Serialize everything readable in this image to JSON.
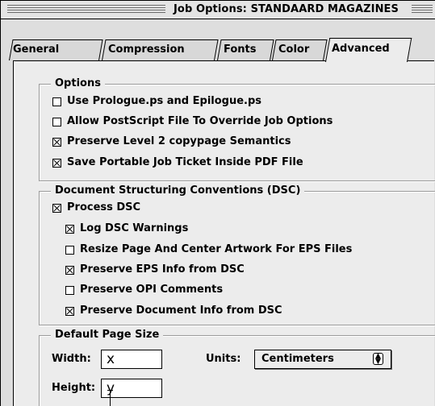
{
  "window": {
    "title": "Job Options: STANDAARD MAGAZINES"
  },
  "tabs": [
    {
      "label": "General",
      "active": false
    },
    {
      "label": "Compression",
      "active": false
    },
    {
      "label": "Fonts",
      "active": false
    },
    {
      "label": "Color",
      "active": false
    },
    {
      "label": "Advanced",
      "active": true
    }
  ],
  "options": {
    "title": "Options",
    "items": [
      {
        "label": "Use Prologue.ps and Epilogue.ps",
        "checked": false
      },
      {
        "label": "Allow PostScript File To Override Job Options",
        "checked": false
      },
      {
        "label": "Preserve Level 2 copypage Semantics",
        "checked": true
      },
      {
        "label": "Save Portable Job Ticket Inside PDF File",
        "checked": true
      }
    ]
  },
  "dsc": {
    "title": "Document Structuring Conventions (DSC)",
    "process": {
      "label": "Process DSC",
      "checked": true
    },
    "items": [
      {
        "label": "Log DSC Warnings",
        "checked": true
      },
      {
        "label": "Resize Page And Center Artwork For EPS Files",
        "checked": false
      },
      {
        "label": "Preserve EPS Info from DSC",
        "checked": true
      },
      {
        "label": "Preserve OPI Comments",
        "checked": false
      },
      {
        "label": "Preserve Document Info from DSC",
        "checked": true
      }
    ]
  },
  "page_size": {
    "title": "Default Page Size",
    "width_label": "Width:",
    "width_value": "x",
    "height_label": "Height:",
    "height_value": "y",
    "units_label": "Units:",
    "units_value": "Centimeters"
  }
}
